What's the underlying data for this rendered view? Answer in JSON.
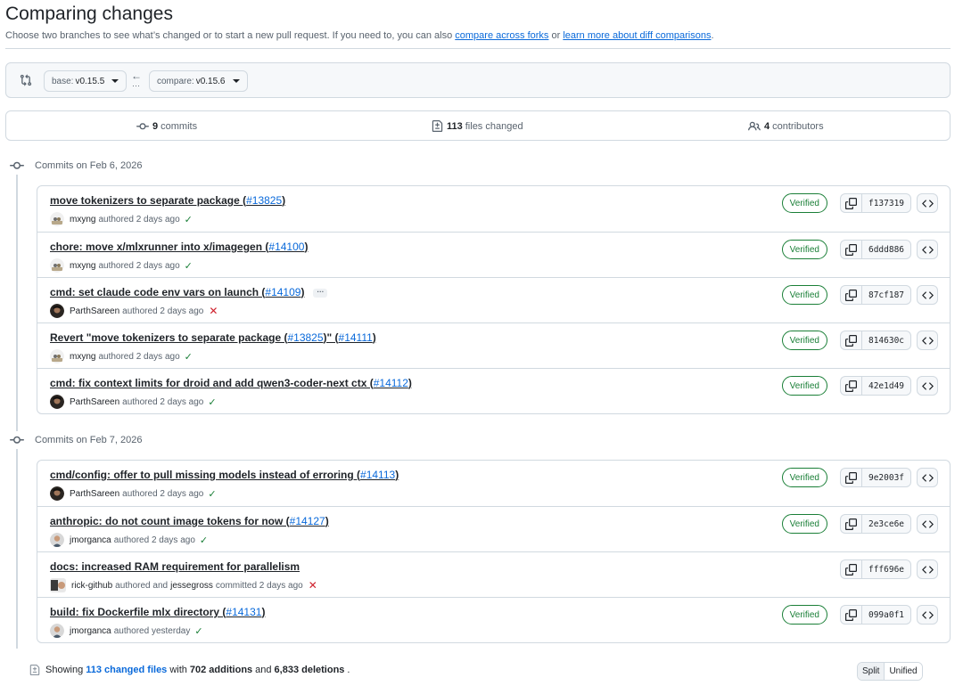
{
  "header": {
    "title": "Comparing changes",
    "subtitle_text": "Choose two branches to see what’s changed or to start a new pull request. If you need to, you can also",
    "link_forks": "compare across forks",
    "subtitle_or": "or",
    "link_learn": "learn more about diff comparisons",
    "subtitle_end": "."
  },
  "range": {
    "base_prefix": "base:",
    "base_value": "v0.15.5",
    "compare_prefix": "compare:",
    "compare_value": "v0.15.6",
    "arrow": "←",
    "dots": "···"
  },
  "stats": {
    "commits_count": "9",
    "commits_label": "commits",
    "files_count": "113",
    "files_label": "files changed",
    "contributors_count": "4",
    "contributors_label": "contributors"
  },
  "groups": [
    {
      "date": "Commits on Feb 6, 2026",
      "commits": [
        {
          "title": "move tokenizers to separate package (",
          "pr": "#13825",
          "title_end": ")",
          "author": "mxyng",
          "meta": "authored 2 days ago",
          "status": "✓",
          "verified": "Verified",
          "sha": "f137319"
        },
        {
          "title": "chore: move x/mlxrunner into x/imagegen (",
          "pr": "#14100",
          "title_end": ")",
          "author": "mxyng",
          "meta": "authored 2 days ago",
          "status": "✓",
          "verified": "Verified",
          "sha": "6ddd886"
        },
        {
          "title": "cmd: set claude code env vars on launch (",
          "pr": "#14109",
          "title_end": ")",
          "ellipsis": "···",
          "author": "ParthSareen",
          "meta": "authored 2 days ago",
          "status": "✕",
          "verified": "Verified",
          "sha": "87cf187"
        },
        {
          "title": "Revert \"move tokenizers to separate package (",
          "pr": "#13825",
          "title_mid": ")\" (",
          "pr2": "#14111",
          "title_end": ")",
          "author": "mxyng",
          "meta": "authored 2 days ago",
          "status": "✓",
          "verified": "Verified",
          "sha": "814630c"
        },
        {
          "title": "cmd: fix context limits for droid and add qwen3-coder-next ctx (",
          "pr": "#14112",
          "title_end": ")",
          "author": "ParthSareen",
          "meta": "authored 2 days ago",
          "status": "✓",
          "verified": "Verified",
          "sha": "42e1d49"
        }
      ]
    },
    {
      "date": "Commits on Feb 7, 2026",
      "commits": [
        {
          "title": "cmd/config: offer to pull missing models instead of erroring (",
          "pr": "#14113",
          "title_end": ")",
          "author": "ParthSareen",
          "meta": "authored 2 days ago",
          "status": "✓",
          "verified": "Verified",
          "sha": "9e2003f"
        },
        {
          "title": "anthropic: do not count image tokens for now (",
          "pr": "#14127",
          "title_end": ")",
          "author": "jmorganca",
          "meta": "authored 2 days ago",
          "status": "✓",
          "verified": "Verified",
          "sha": "2e3ce6e"
        },
        {
          "title": "docs: increased RAM requirement for parallelism",
          "author": "rick-github",
          "meta_mid": "authored and",
          "author2": "jessegross",
          "meta": "committed 2 days ago",
          "status": "✕",
          "sha": "fff696e"
        },
        {
          "title": "build: fix Dockerfile mlx directory (",
          "pr": "#14131",
          "title_end": ")",
          "author": "jmorganca",
          "meta": "authored yesterday",
          "status": "✓",
          "verified": "Verified",
          "sha": "099a0f1"
        }
      ]
    }
  ],
  "footer": {
    "showing": "Showing",
    "changed_files": "113 changed files",
    "with": "with",
    "additions": "702 additions",
    "and": "and",
    "deletions": "6,833 deletions",
    "end": ".",
    "split": "Split",
    "unified": "Unified"
  },
  "icons": {
    "range": "git-compare-icon",
    "commits": "git-commit-icon",
    "files": "file-diff-icon",
    "contributors": "people-icon",
    "copy": "copy-icon",
    "browse": "code-icon"
  },
  "colors": {
    "link": "#0969da",
    "success": "#1a7f37",
    "danger": "#cf222e",
    "border": "#d1d9e0"
  }
}
